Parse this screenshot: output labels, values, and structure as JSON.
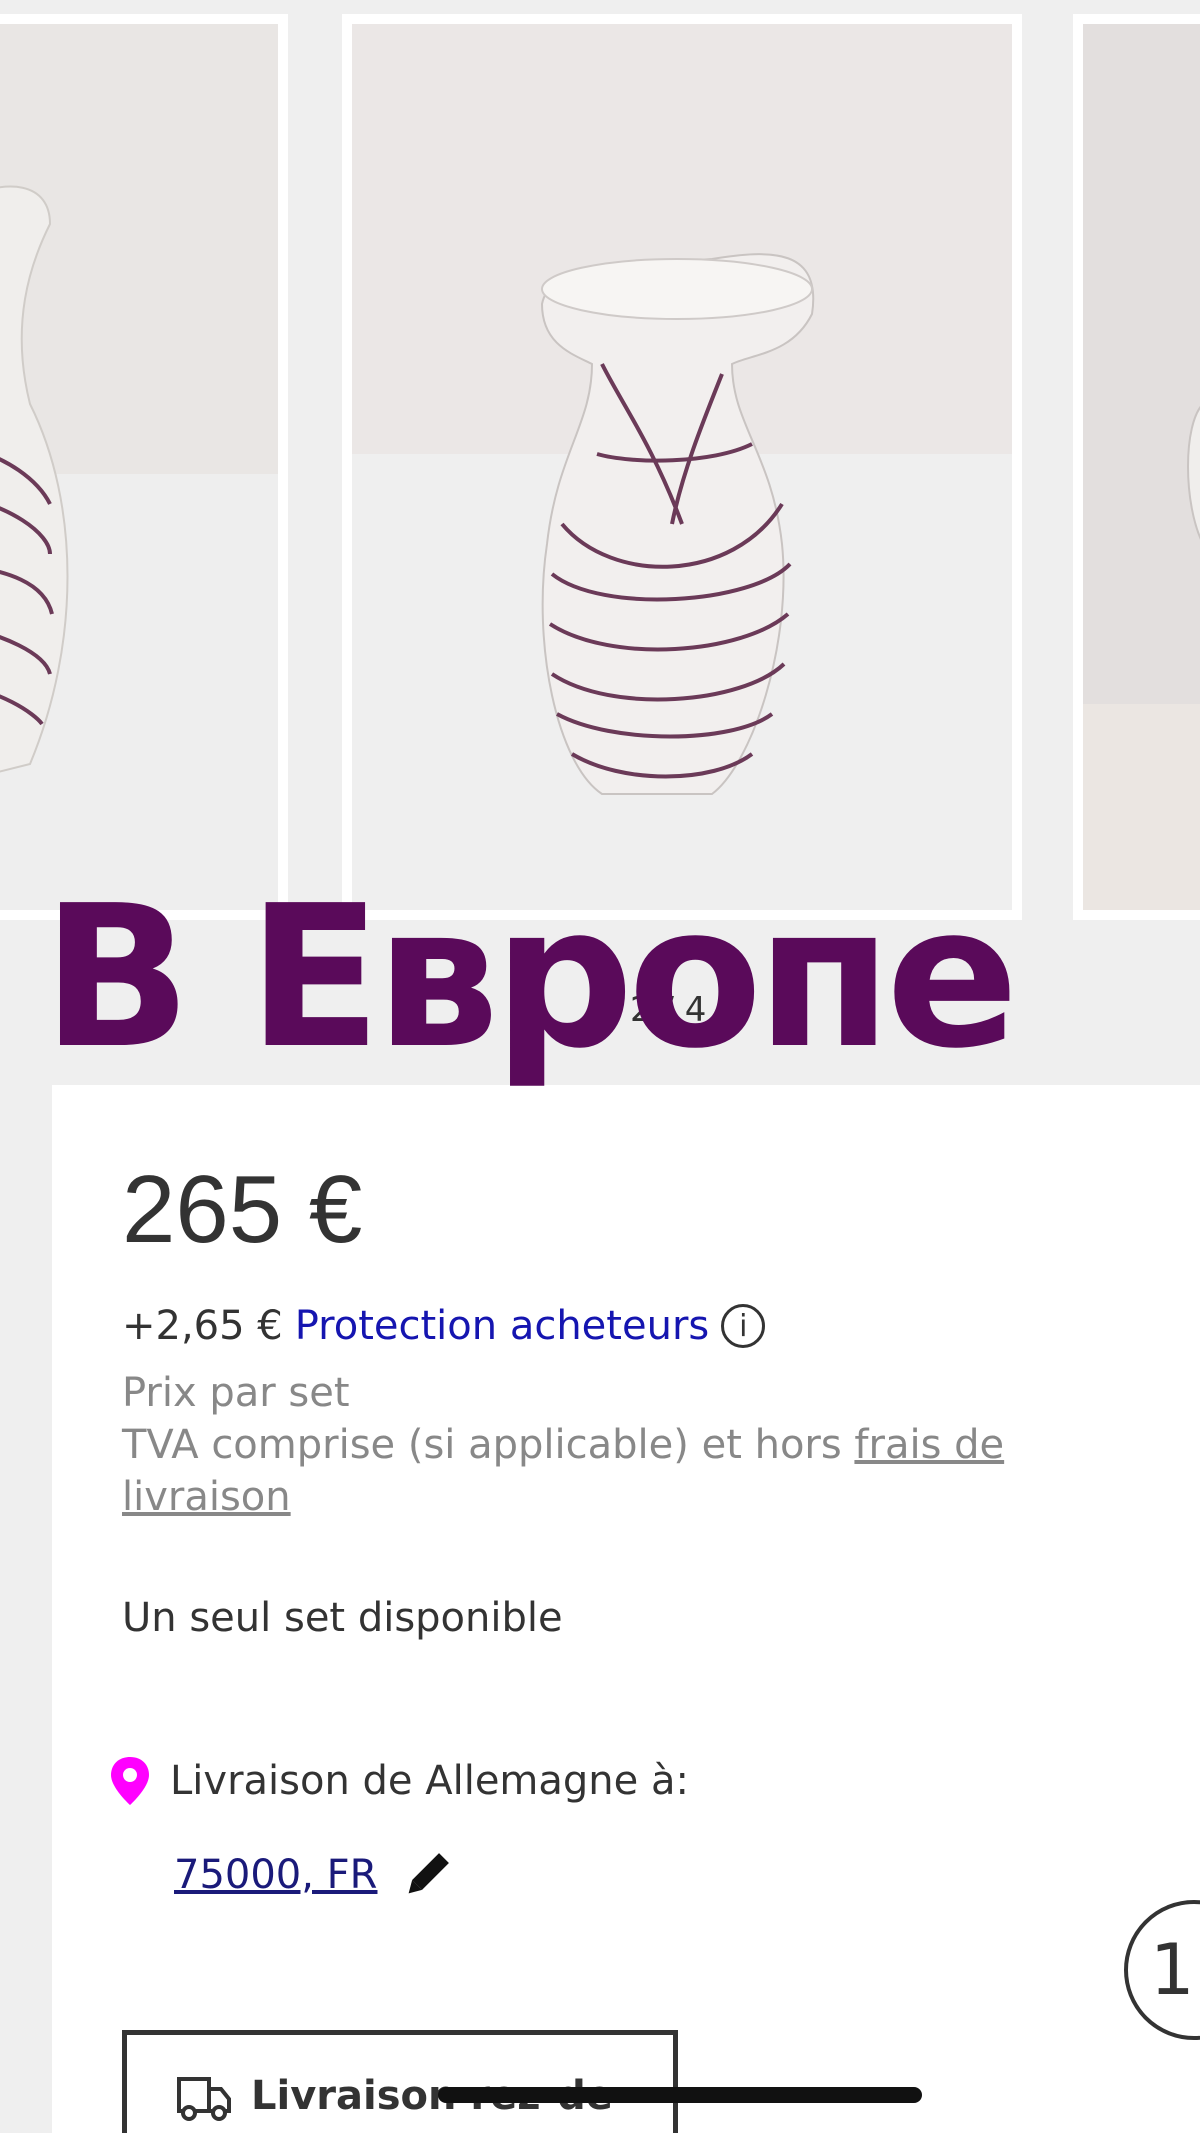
{
  "gallery": {
    "counter": "2 / 4",
    "slides": [
      {
        "icon": "vase-photo-left"
      },
      {
        "icon": "vase-photo-center"
      },
      {
        "icon": "vase-photo-right"
      }
    ]
  },
  "overlay": {
    "text": "В Европе",
    "color": "#5a0a5a"
  },
  "listing": {
    "price": "265 €",
    "protection_fee": "+2,65 €",
    "protection_label": "Protection acheteurs",
    "info_icon": "i",
    "unit_note": "Prix par set",
    "vat_note_prefix": "TVA comprise (si applicable) et hors ",
    "vat_note_link": "frais de livraison",
    "availability": "Un seul set disponible"
  },
  "shipping": {
    "from_label": "Livraison de Allemagne à:",
    "zip": "75000, FR",
    "option_label": "Livraison rez-de-",
    "pin_color": "#ff00ff",
    "link_color": "#1515b0"
  },
  "scroll_top": {
    "label": "1"
  }
}
